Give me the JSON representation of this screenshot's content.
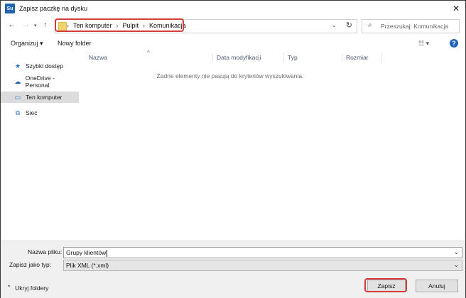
{
  "window": {
    "title": "Zapisz paczkę na dysku",
    "app_icon_text": "Su"
  },
  "nav": {
    "back_icon": "arrow-left-icon",
    "forward_icon": "arrow-right-icon",
    "recent_icon": "chevron-down-icon",
    "up_icon": "arrow-up-icon"
  },
  "address": {
    "crumbs": [
      "Ten komputer",
      "Pulpit",
      "Komunikacja"
    ],
    "highlight_color": "#d63b3b"
  },
  "search": {
    "placeholder": "Przeszukaj: Komunikacja"
  },
  "toolbar": {
    "organize_label": "Organizuj ▾",
    "new_folder_label": "Nowy folder",
    "view_label": "☷ ▾",
    "help_label": "?"
  },
  "sidebar": {
    "items": [
      {
        "label": "Szybki dostęp",
        "icon": "star-icon"
      },
      {
        "label": "OneDrive - Personal",
        "icon": "cloud-icon"
      },
      {
        "label": "Ten komputer",
        "icon": "computer-icon"
      },
      {
        "label": "Sieć",
        "icon": "network-icon"
      }
    ],
    "selected": "Ten komputer"
  },
  "file_list": {
    "columns": [
      "Nazwa",
      "Data modyfikacji",
      "Typ",
      "Rozmiar"
    ],
    "empty_message": "Żadne elementy nie pasują do kryteriów wyszukiwania."
  },
  "form": {
    "filename_label": "Nazwa pliku:",
    "filename_value": "Grupy klientów",
    "filetype_label": "Zapisz jako typ:",
    "filetype_value": "Plik XML (*.xml)"
  },
  "footer": {
    "hide_folders_label": "Ukryj foldery",
    "save_label": "Zapisz",
    "cancel_label": "Anuluj"
  },
  "colors": {
    "accent": "#1e63b5",
    "highlight": "#d63b3b",
    "folder": "#f3d36b"
  }
}
